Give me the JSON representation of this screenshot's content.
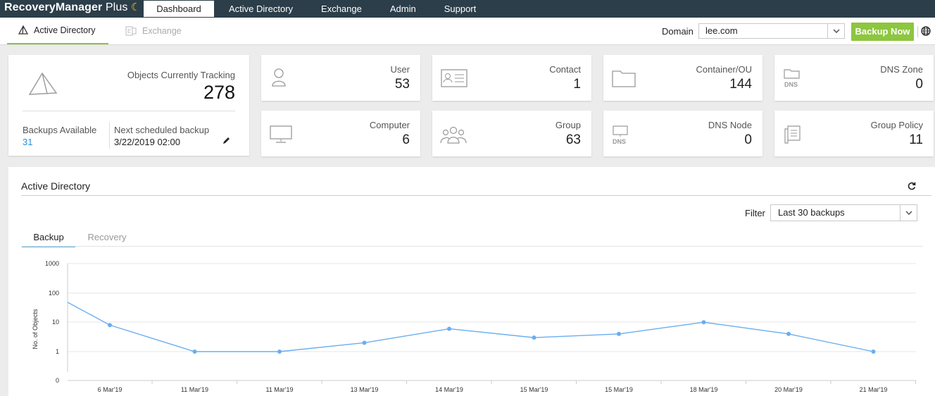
{
  "app": {
    "name": "RecoveryManager",
    "name_suffix": "Plus"
  },
  "topnav": [
    "Dashboard",
    "Active Directory",
    "Exchange",
    "Admin",
    "Support"
  ],
  "subnav": {
    "active": "Active Directory",
    "disabled": "Exchange"
  },
  "domain": {
    "label": "Domain",
    "value": "lee.com"
  },
  "backup_now": "Backup Now",
  "summary": {
    "tracking_label": "Objects Currently Tracking",
    "tracking_value": "278",
    "backups_label": "Backups Available",
    "backups_value": "31",
    "next_label": "Next scheduled backup",
    "next_value": "3/22/2019 02:00"
  },
  "stats": [
    {
      "label": "User",
      "value": "53",
      "icon": "user-icon"
    },
    {
      "label": "Contact",
      "value": "1",
      "icon": "contact-card-icon"
    },
    {
      "label": "Container/OU",
      "value": "144",
      "icon": "folder-icon"
    },
    {
      "label": "DNS Zone",
      "value": "0",
      "icon": "dns-zone-icon"
    },
    {
      "label": "Computer",
      "value": "6",
      "icon": "computer-icon"
    },
    {
      "label": "Group",
      "value": "63",
      "icon": "group-icon"
    },
    {
      "label": "DNS Node",
      "value": "0",
      "icon": "dns-node-icon"
    },
    {
      "label": "Group Policy",
      "value": "11",
      "icon": "group-policy-icon"
    }
  ],
  "panel": {
    "title": "Active Directory",
    "filter_label": "Filter",
    "filter_value": "Last 30 backups",
    "tabs": [
      "Backup",
      "Recovery"
    ]
  },
  "colors": {
    "accent_green": "#8dc63f",
    "topbar": "#2c3e4a",
    "line": "#6aaef0",
    "link": "#2a8fd6"
  },
  "chart_data": {
    "type": "line",
    "ylabel": "No. of Objects",
    "yscale": "log",
    "yticks": [
      "1000",
      "100",
      "10",
      "1",
      "0"
    ],
    "categories": [
      "6 Mar'19",
      "11 Mar'19",
      "11 Mar'19",
      "13 Mar'19",
      "14 Mar'19",
      "15 Mar'19",
      "15 Mar'19",
      "18 Mar'19",
      "20 Mar'19",
      "21 Mar'19"
    ],
    "start_value": 48,
    "values": [
      8,
      1,
      1,
      2,
      6,
      3,
      4,
      10,
      4,
      1
    ]
  }
}
